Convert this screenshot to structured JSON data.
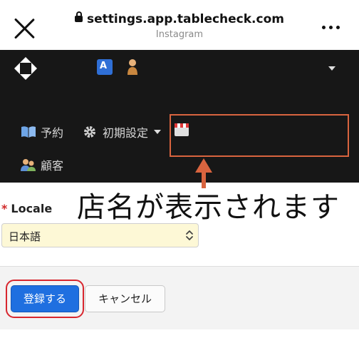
{
  "browser": {
    "url": "settings.app.tablecheck.com",
    "source": "Instagram"
  },
  "header": {
    "user_name": "",
    "nav": {
      "reservations": "予約",
      "settings": "初期設定",
      "store_name": "",
      "customers": "顧客"
    }
  },
  "annotation": {
    "callout": "店名が表示されます"
  },
  "form": {
    "locale_label": "Locale",
    "required_mark": "*",
    "locale_value": "日本語"
  },
  "actions": {
    "submit_label": "登録する",
    "cancel_label": "キャンセル"
  },
  "colors": {
    "header_bg": "#171717",
    "annotation_accent": "#d9643f",
    "primary_button": "#1f6fe0",
    "highlight_ring": "#d8262e",
    "select_bg": "#fdf8d6"
  },
  "icons": [
    "close-icon",
    "lock-icon",
    "more-icon",
    "tablecheck-logo",
    "translate-icon",
    "user-icon",
    "book-icon",
    "gear-icon",
    "store-icon",
    "customers-icon",
    "chevron-updown-icon",
    "up-arrow-icon"
  ]
}
